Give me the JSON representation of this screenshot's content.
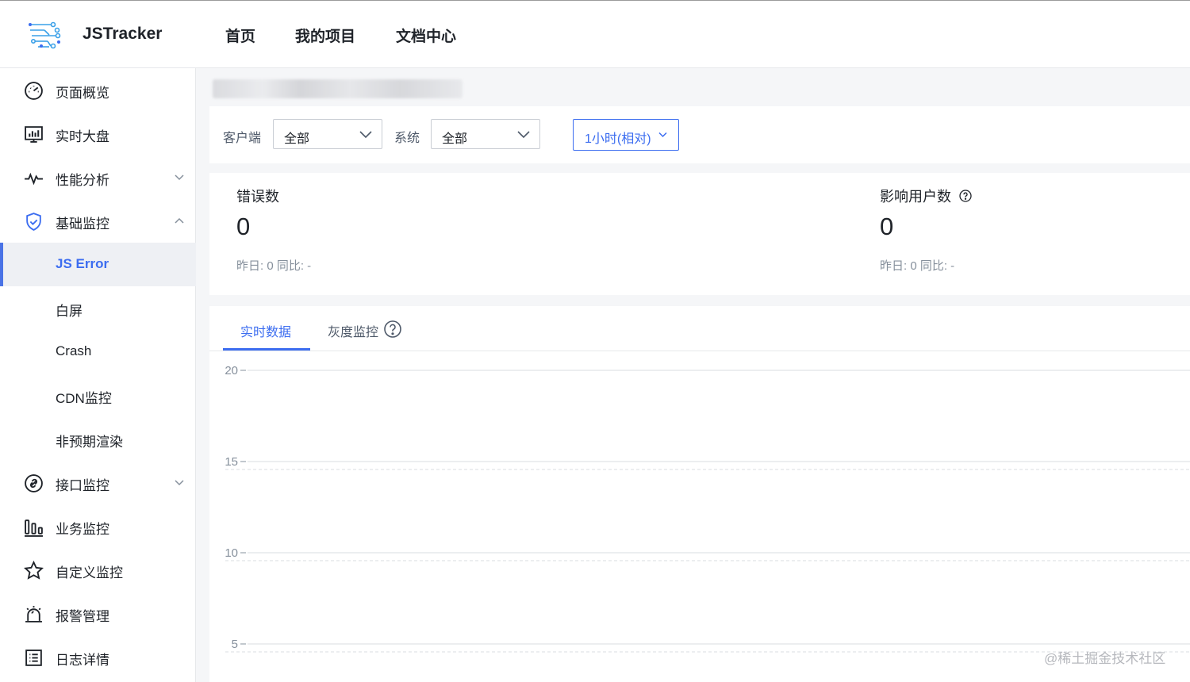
{
  "header": {
    "brand": "JSTracker",
    "nav": [
      "首页",
      "我的项目",
      "文档中心"
    ]
  },
  "sidebar": {
    "items": [
      {
        "label": "页面概览",
        "icon": "dashboard-gauge-icon"
      },
      {
        "label": "实时大盘",
        "icon": "monitor-chart-icon"
      },
      {
        "label": "性能分析",
        "icon": "pulse-icon",
        "caret": "down"
      },
      {
        "label": "基础监控",
        "icon": "shield-check-icon",
        "caret": "up"
      },
      {
        "label": "JS Error",
        "active": true
      },
      {
        "label": "白屏"
      },
      {
        "label": "Crash"
      },
      {
        "label": "CDN监控"
      },
      {
        "label": "非预期渲染"
      },
      {
        "label": "接口监控",
        "icon": "api-link-icon",
        "caret": "down"
      },
      {
        "label": "业务监控",
        "icon": "bar-columns-icon"
      },
      {
        "label": "自定义监控",
        "icon": "star-icon"
      },
      {
        "label": "报警管理",
        "icon": "alarm-siren-icon"
      },
      {
        "label": "日志详情",
        "icon": "log-list-icon"
      }
    ],
    "accent": "#3c6df0"
  },
  "filters": {
    "client_label": "客户端",
    "client_value": "全部",
    "system_label": "系统",
    "system_value": "全部",
    "time_range": "1小时(相对)"
  },
  "stats": {
    "errors": {
      "title": "错误数",
      "value": "0",
      "footer": "昨日: 0  同比: -"
    },
    "users": {
      "title": "影响用户数",
      "value": "0",
      "footer": "昨日: 0  同比: -"
    }
  },
  "tabs": [
    "实时数据",
    "灰度监控"
  ],
  "chart_data": {
    "type": "line",
    "y_ticks": [
      "20",
      "15",
      "10",
      "5"
    ],
    "series": [],
    "grid": true
  },
  "watermark": "@稀土掘金技术社区"
}
